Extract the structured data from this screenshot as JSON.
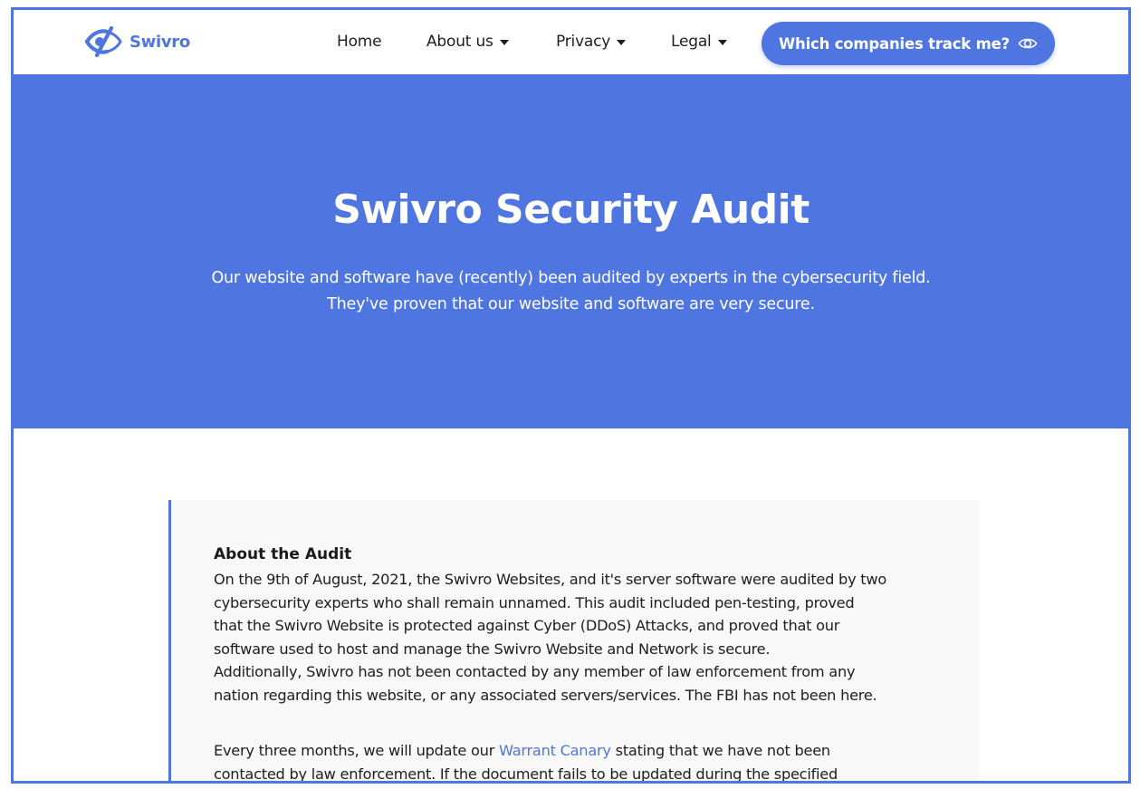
{
  "nav": {
    "brand": "Swivro",
    "links": [
      {
        "label": "Home"
      },
      {
        "label": "About us"
      },
      {
        "label": "Privacy"
      },
      {
        "label": "Legal"
      }
    ],
    "cta_label": "Which companies track me?"
  },
  "hero": {
    "title": "Swivro Security Audit",
    "subtitle_line1": "Our website and software have (recently) been audited by experts in the cybersecurity field.",
    "subtitle_line2": "They've proven that our website and software are very secure."
  },
  "card": {
    "heading": "About the Audit",
    "para1": [
      "On the 9th of August, 2021, the Swivro Websites, and it's server software were audited by two",
      "cybersecurity experts who shall remain unnamed. This audit included pen-testing, proved",
      "that the Swivro Website is protected against Cyber (DDoS) Attacks, and proved that our",
      "software used to host and manage the Swivro Website and Network is secure.",
      "Additionally, Swivro has not been contacted by any member of law enforcement from any",
      "nation regarding this website, or any associated servers/services. The FBI has not been here."
    ],
    "para2_before_link": "Every three months, we will update our ",
    "para2_link": "Warrant Canary",
    "para2_after_link": " stating that we have not been",
    "para2_line2": "contacted by law enforcement. If the document fails to be updated during the specified"
  },
  "colors": {
    "accent": "#4f76e0",
    "card_bg": "#f8f8f8"
  }
}
